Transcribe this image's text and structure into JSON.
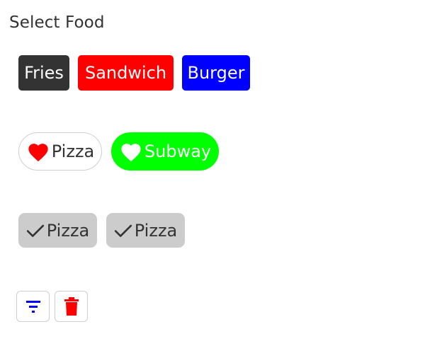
{
  "header": {
    "title": "Select Food"
  },
  "solid_chips": [
    {
      "label": "Fries",
      "bg": "#333333"
    },
    {
      "label": "Sandwich",
      "bg": "#ff0000"
    },
    {
      "label": "Burger",
      "bg": "#0000ff"
    }
  ],
  "favorite_chips": [
    {
      "label": "Pizza",
      "icon": "heart-icon",
      "icon_color": "#ff0000",
      "bg": "#ffffff"
    },
    {
      "label": "Subway",
      "icon": "heart-icon",
      "icon_color": "#ffffff",
      "bg": "#00ff00"
    }
  ],
  "check_chips": [
    {
      "label": "Pizza",
      "icon": "check-icon",
      "bg": "#cccccc"
    },
    {
      "label": "Pizza",
      "icon": "check-icon",
      "bg": "#cccccc"
    }
  ],
  "action_buttons": [
    {
      "icon": "filter-icon",
      "color": "#0000ff"
    },
    {
      "icon": "trash-icon",
      "color": "#ff0000"
    }
  ]
}
